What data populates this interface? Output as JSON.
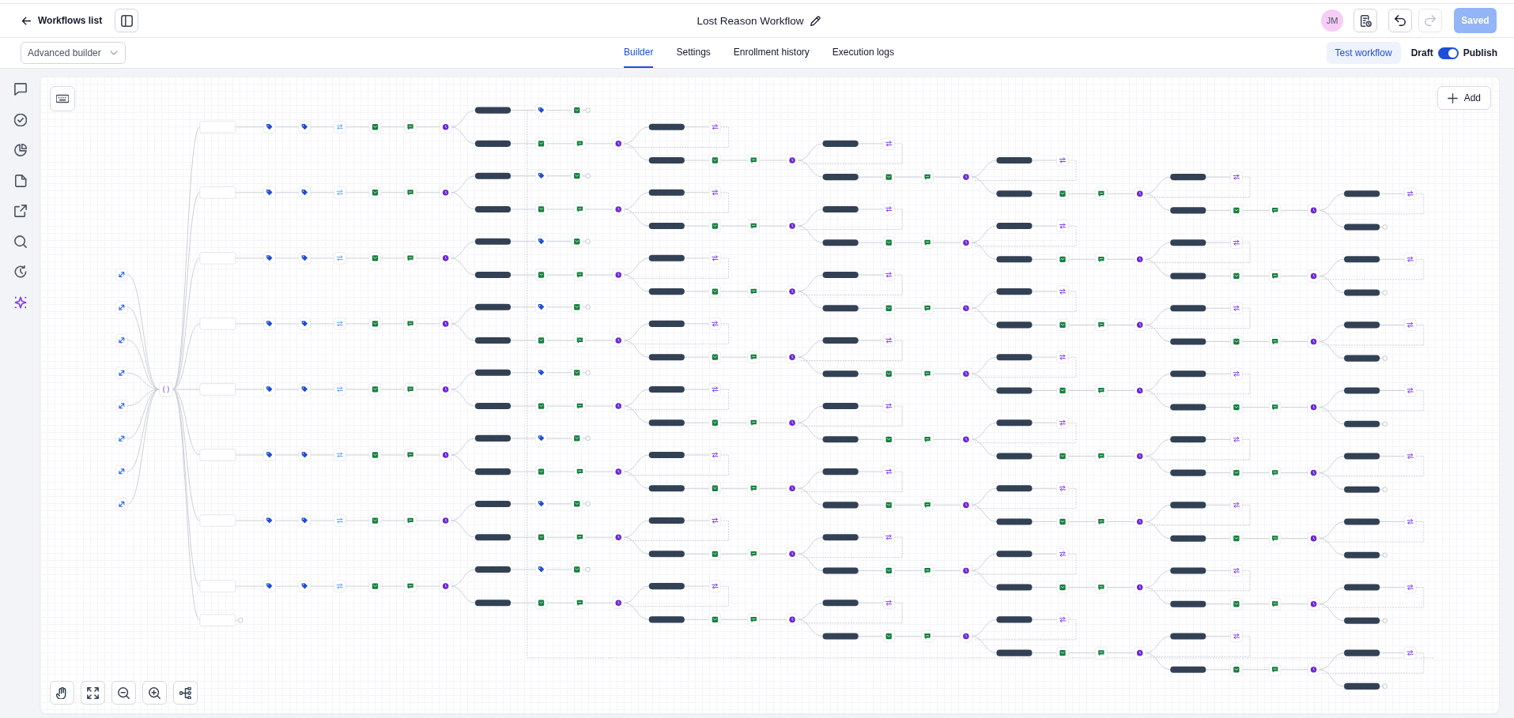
{
  "header": {
    "back_link": "Workflows list",
    "title": "Lost Reason Workflow",
    "avatar": "JM",
    "undo": {
      "disabled": false
    },
    "redo": {
      "disabled": true
    },
    "save_button": {
      "label": "Saved",
      "disabled": true
    }
  },
  "toolbar": {
    "builder_mode": "Advanced builder",
    "tabs": [
      {
        "label": "Builder",
        "selected": true
      },
      {
        "label": "Settings",
        "selected": false
      },
      {
        "label": "Enrollment history",
        "selected": false
      },
      {
        "label": "Execution logs",
        "selected": false
      }
    ],
    "test_button": "Test workflow",
    "publish": {
      "off_label": "Draft",
      "on_label": "Publish",
      "on": true
    }
  },
  "rail": [
    {
      "kind": "chat"
    },
    {
      "kind": "check"
    },
    {
      "kind": "pie"
    },
    {
      "kind": "note"
    },
    {
      "kind": "external"
    },
    {
      "kind": "search"
    },
    {
      "kind": "history"
    },
    {
      "kind": "sparkle"
    }
  ],
  "canvas": {
    "corner_tools": [
      {
        "kind": "keyboard"
      }
    ],
    "add_button": "Add",
    "view_controls": [
      {
        "kind": "hand"
      },
      {
        "kind": "fit"
      },
      {
        "kind": "zoom-out"
      },
      {
        "kind": "zoom-in"
      },
      {
        "kind": "layout"
      }
    ],
    "workflow": {
      "triggers": [
        {
          "kind": "trigger"
        },
        {
          "kind": "trigger"
        },
        {
          "kind": "trigger"
        },
        {
          "kind": "trigger"
        },
        {
          "kind": "trigger"
        },
        {
          "kind": "trigger"
        },
        {
          "kind": "trigger"
        },
        {
          "kind": "trigger"
        }
      ],
      "router": {
        "kind": "condition"
      },
      "branches": [
        {
          "steps": [
            {
              "kind": "tag"
            },
            {
              "kind": "tag"
            },
            {
              "kind": "update"
            },
            {
              "kind": "email"
            },
            {
              "kind": "sms"
            },
            {
              "kind": "wait"
            }
          ],
          "rounds": [
            {
              "upper": [
                {
                  "kind": "tag"
                },
                {
                  "kind": "email"
                },
                {
                  "kind": "end"
                }
              ],
              "lower": [
                {
                  "kind": "email"
                },
                {
                  "kind": "sms"
                },
                {
                  "kind": "wait"
                }
              ]
            },
            {
              "upper": [
                {
                  "kind": "goto"
                }
              ],
              "lower": [
                {
                  "kind": "email"
                },
                {
                  "kind": "sms"
                },
                {
                  "kind": "wait"
                }
              ]
            },
            {
              "upper": [
                {
                  "kind": "goto"
                }
              ],
              "lower": [
                {
                  "kind": "email"
                },
                {
                  "kind": "sms"
                },
                {
                  "kind": "wait"
                }
              ]
            },
            {
              "upper": [
                {
                  "kind": "goto"
                }
              ],
              "lower": [
                {
                  "kind": "email"
                },
                {
                  "kind": "sms"
                },
                {
                  "kind": "wait"
                }
              ]
            },
            {
              "upper": [
                {
                  "kind": "goto"
                }
              ],
              "lower": [
                {
                  "kind": "email"
                },
                {
                  "kind": "sms"
                },
                {
                  "kind": "wait"
                }
              ]
            },
            {
              "upper": [
                {
                  "kind": "goto"
                }
              ],
              "lower": [
                {
                  "kind": "end"
                }
              ]
            }
          ]
        },
        {
          "steps": [
            {
              "kind": "tag"
            },
            {
              "kind": "tag"
            },
            {
              "kind": "update"
            },
            {
              "kind": "email"
            },
            {
              "kind": "sms"
            },
            {
              "kind": "wait"
            }
          ],
          "rounds": [
            {
              "upper": [
                {
                  "kind": "tag"
                },
                {
                  "kind": "email"
                },
                {
                  "kind": "end"
                }
              ],
              "lower": [
                {
                  "kind": "email"
                },
                {
                  "kind": "sms"
                },
                {
                  "kind": "wait"
                }
              ]
            },
            {
              "upper": [
                {
                  "kind": "goto"
                }
              ],
              "lower": [
                {
                  "kind": "email"
                },
                {
                  "kind": "sms"
                },
                {
                  "kind": "wait"
                }
              ]
            },
            {
              "upper": [
                {
                  "kind": "goto"
                }
              ],
              "lower": [
                {
                  "kind": "email"
                },
                {
                  "kind": "sms"
                },
                {
                  "kind": "wait"
                }
              ]
            },
            {
              "upper": [
                {
                  "kind": "goto"
                }
              ],
              "lower": [
                {
                  "kind": "email"
                },
                {
                  "kind": "sms"
                },
                {
                  "kind": "wait"
                }
              ]
            },
            {
              "upper": [
                {
                  "kind": "goto"
                }
              ],
              "lower": [
                {
                  "kind": "email"
                },
                {
                  "kind": "sms"
                },
                {
                  "kind": "wait"
                }
              ]
            },
            {
              "upper": [
                {
                  "kind": "goto"
                }
              ],
              "lower": [
                {
                  "kind": "end"
                }
              ]
            }
          ]
        },
        {
          "steps": [
            {
              "kind": "tag"
            },
            {
              "kind": "tag"
            },
            {
              "kind": "update"
            },
            {
              "kind": "email"
            },
            {
              "kind": "sms"
            },
            {
              "kind": "wait"
            }
          ],
          "rounds": [
            {
              "upper": [
                {
                  "kind": "tag"
                },
                {
                  "kind": "email"
                },
                {
                  "kind": "end"
                }
              ],
              "lower": [
                {
                  "kind": "email"
                },
                {
                  "kind": "sms"
                },
                {
                  "kind": "wait"
                }
              ]
            },
            {
              "upper": [
                {
                  "kind": "goto"
                }
              ],
              "lower": [
                {
                  "kind": "email"
                },
                {
                  "kind": "sms"
                },
                {
                  "kind": "wait"
                }
              ]
            },
            {
              "upper": [
                {
                  "kind": "goto"
                }
              ],
              "lower": [
                {
                  "kind": "email"
                },
                {
                  "kind": "sms"
                },
                {
                  "kind": "wait"
                }
              ]
            },
            {
              "upper": [
                {
                  "kind": "goto"
                }
              ],
              "lower": [
                {
                  "kind": "email"
                },
                {
                  "kind": "sms"
                },
                {
                  "kind": "wait"
                }
              ]
            },
            {
              "upper": [
                {
                  "kind": "goto"
                }
              ],
              "lower": [
                {
                  "kind": "email"
                },
                {
                  "kind": "sms"
                },
                {
                  "kind": "wait"
                }
              ]
            },
            {
              "upper": [
                {
                  "kind": "goto"
                }
              ],
              "lower": [
                {
                  "kind": "end"
                }
              ]
            }
          ]
        },
        {
          "steps": [
            {
              "kind": "tag"
            },
            {
              "kind": "tag"
            },
            {
              "kind": "update"
            },
            {
              "kind": "email"
            },
            {
              "kind": "sms"
            },
            {
              "kind": "wait"
            }
          ],
          "rounds": [
            {
              "upper": [
                {
                  "kind": "tag"
                },
                {
                  "kind": "email"
                },
                {
                  "kind": "end"
                }
              ],
              "lower": [
                {
                  "kind": "email"
                },
                {
                  "kind": "sms"
                },
                {
                  "kind": "wait"
                }
              ]
            },
            {
              "upper": [
                {
                  "kind": "goto"
                }
              ],
              "lower": [
                {
                  "kind": "email"
                },
                {
                  "kind": "sms"
                },
                {
                  "kind": "wait"
                }
              ]
            },
            {
              "upper": [
                {
                  "kind": "goto"
                }
              ],
              "lower": [
                {
                  "kind": "email"
                },
                {
                  "kind": "sms"
                },
                {
                  "kind": "wait"
                }
              ]
            },
            {
              "upper": [
                {
                  "kind": "goto"
                }
              ],
              "lower": [
                {
                  "kind": "email"
                },
                {
                  "kind": "sms"
                },
                {
                  "kind": "wait"
                }
              ]
            },
            {
              "upper": [
                {
                  "kind": "goto"
                }
              ],
              "lower": [
                {
                  "kind": "email"
                },
                {
                  "kind": "sms"
                },
                {
                  "kind": "wait"
                }
              ]
            },
            {
              "upper": [
                {
                  "kind": "goto"
                }
              ],
              "lower": [
                {
                  "kind": "end"
                }
              ]
            }
          ]
        },
        {
          "steps": [
            {
              "kind": "tag"
            },
            {
              "kind": "tag"
            },
            {
              "kind": "update"
            },
            {
              "kind": "email"
            },
            {
              "kind": "sms"
            },
            {
              "kind": "wait"
            }
          ],
          "rounds": [
            {
              "upper": [
                {
                  "kind": "tag"
                },
                {
                  "kind": "email"
                },
                {
                  "kind": "end"
                }
              ],
              "lower": [
                {
                  "kind": "email"
                },
                {
                  "kind": "sms"
                },
                {
                  "kind": "wait"
                }
              ]
            },
            {
              "upper": [
                {
                  "kind": "goto"
                }
              ],
              "lower": [
                {
                  "kind": "email"
                },
                {
                  "kind": "sms"
                },
                {
                  "kind": "wait"
                }
              ]
            },
            {
              "upper": [
                {
                  "kind": "goto"
                }
              ],
              "lower": [
                {
                  "kind": "email"
                },
                {
                  "kind": "sms"
                },
                {
                  "kind": "wait"
                }
              ]
            },
            {
              "upper": [
                {
                  "kind": "goto"
                }
              ],
              "lower": [
                {
                  "kind": "email"
                },
                {
                  "kind": "sms"
                },
                {
                  "kind": "wait"
                }
              ]
            },
            {
              "upper": [
                {
                  "kind": "goto"
                }
              ],
              "lower": [
                {
                  "kind": "email"
                },
                {
                  "kind": "sms"
                },
                {
                  "kind": "wait"
                }
              ]
            },
            {
              "upper": [
                {
                  "kind": "goto"
                }
              ],
              "lower": [
                {
                  "kind": "end"
                }
              ]
            }
          ]
        },
        {
          "steps": [
            {
              "kind": "tag"
            },
            {
              "kind": "tag"
            },
            {
              "kind": "update"
            },
            {
              "kind": "email"
            },
            {
              "kind": "sms"
            },
            {
              "kind": "wait"
            }
          ],
          "rounds": [
            {
              "upper": [
                {
                  "kind": "tag"
                },
                {
                  "kind": "email"
                },
                {
                  "kind": "end"
                }
              ],
              "lower": [
                {
                  "kind": "email"
                },
                {
                  "kind": "sms"
                },
                {
                  "kind": "wait"
                }
              ]
            },
            {
              "upper": [
                {
                  "kind": "goto"
                }
              ],
              "lower": [
                {
                  "kind": "email"
                },
                {
                  "kind": "sms"
                },
                {
                  "kind": "wait"
                }
              ]
            },
            {
              "upper": [
                {
                  "kind": "goto"
                }
              ],
              "lower": [
                {
                  "kind": "email"
                },
                {
                  "kind": "sms"
                },
                {
                  "kind": "wait"
                }
              ]
            },
            {
              "upper": [
                {
                  "kind": "goto"
                }
              ],
              "lower": [
                {
                  "kind": "email"
                },
                {
                  "kind": "sms"
                },
                {
                  "kind": "wait"
                }
              ]
            },
            {
              "upper": [
                {
                  "kind": "goto"
                }
              ],
              "lower": [
                {
                  "kind": "email"
                },
                {
                  "kind": "sms"
                },
                {
                  "kind": "wait"
                }
              ]
            },
            {
              "upper": [
                {
                  "kind": "goto"
                }
              ],
              "lower": [
                {
                  "kind": "end"
                }
              ]
            }
          ]
        },
        {
          "steps": [
            {
              "kind": "tag"
            },
            {
              "kind": "tag"
            },
            {
              "kind": "update"
            },
            {
              "kind": "email"
            },
            {
              "kind": "sms"
            },
            {
              "kind": "wait"
            }
          ],
          "rounds": [
            {
              "upper": [
                {
                  "kind": "tag"
                },
                {
                  "kind": "email"
                },
                {
                  "kind": "end"
                }
              ],
              "lower": [
                {
                  "kind": "email"
                },
                {
                  "kind": "sms"
                },
                {
                  "kind": "wait"
                }
              ]
            },
            {
              "upper": [
                {
                  "kind": "goto"
                }
              ],
              "lower": [
                {
                  "kind": "email"
                },
                {
                  "kind": "sms"
                },
                {
                  "kind": "wait"
                }
              ]
            },
            {
              "upper": [
                {
                  "kind": "goto"
                }
              ],
              "lower": [
                {
                  "kind": "email"
                },
                {
                  "kind": "sms"
                },
                {
                  "kind": "wait"
                }
              ]
            },
            {
              "upper": [
                {
                  "kind": "goto"
                }
              ],
              "lower": [
                {
                  "kind": "email"
                },
                {
                  "kind": "sms"
                },
                {
                  "kind": "wait"
                }
              ]
            },
            {
              "upper": [
                {
                  "kind": "goto"
                }
              ],
              "lower": [
                {
                  "kind": "email"
                },
                {
                  "kind": "sms"
                },
                {
                  "kind": "wait"
                }
              ]
            },
            {
              "upper": [
                {
                  "kind": "goto"
                }
              ],
              "lower": [
                {
                  "kind": "end"
                }
              ]
            }
          ]
        },
        {
          "steps": [
            {
              "kind": "tag"
            },
            {
              "kind": "tag"
            },
            {
              "kind": "update"
            },
            {
              "kind": "email"
            },
            {
              "kind": "sms"
            },
            {
              "kind": "wait"
            }
          ],
          "rounds": [
            {
              "upper": [
                {
                  "kind": "tag"
                },
                {
                  "kind": "email"
                },
                {
                  "kind": "end"
                }
              ],
              "lower": [
                {
                  "kind": "email"
                },
                {
                  "kind": "sms"
                },
                {
                  "kind": "wait"
                }
              ]
            },
            {
              "upper": [
                {
                  "kind": "goto"
                }
              ],
              "lower": [
                {
                  "kind": "email"
                },
                {
                  "kind": "sms"
                },
                {
                  "kind": "wait"
                }
              ]
            },
            {
              "upper": [
                {
                  "kind": "goto"
                }
              ],
              "lower": [
                {
                  "kind": "email"
                },
                {
                  "kind": "sms"
                },
                {
                  "kind": "wait"
                }
              ]
            },
            {
              "upper": [
                {
                  "kind": "goto"
                }
              ],
              "lower": [
                {
                  "kind": "email"
                },
                {
                  "kind": "sms"
                },
                {
                  "kind": "wait"
                }
              ]
            },
            {
              "upper": [
                {
                  "kind": "goto"
                }
              ],
              "lower": [
                {
                  "kind": "email"
                },
                {
                  "kind": "sms"
                },
                {
                  "kind": "wait"
                }
              ]
            },
            {
              "upper": [
                {
                  "kind": "goto"
                }
              ],
              "lower": [
                {
                  "kind": "end"
                }
              ]
            }
          ]
        },
        {
          "steps": [
            {
              "kind": "end"
            }
          ]
        }
      ]
    }
  }
}
